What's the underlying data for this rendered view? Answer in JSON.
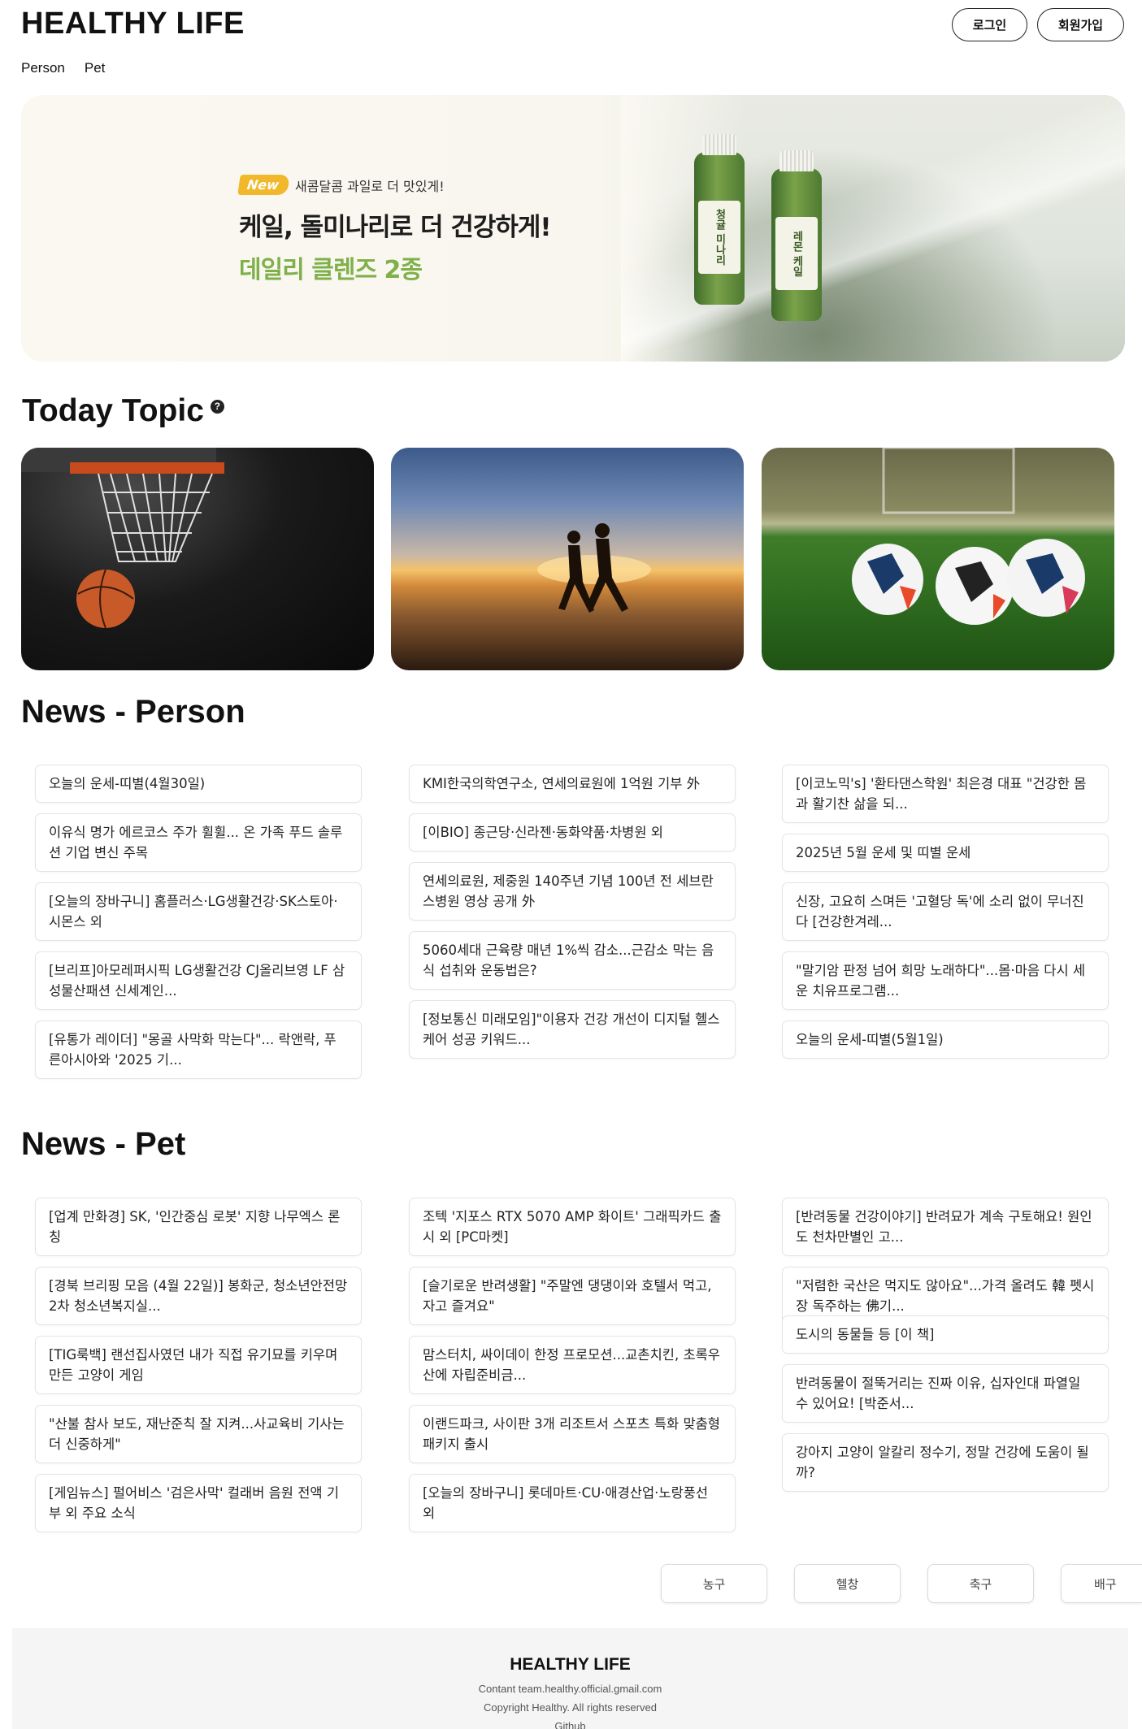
{
  "header": {
    "logo": "HEALTHY LIFE",
    "login_label": "로그인",
    "signup_label": "회원가입"
  },
  "nav": {
    "items": [
      "Person",
      "Pet"
    ]
  },
  "hero": {
    "badge": "New",
    "tagline": "새콤달콤 과일로 더 맛있게!",
    "title": "케일, 돌미나리로 더 건강하게!",
    "subtitle": "데일리 클렌즈 2종",
    "bottle_labels": [
      "청귤 미나리",
      "레몬 케일"
    ]
  },
  "topic": {
    "title": "Today Topic",
    "help_icon": "?"
  },
  "news_person": {
    "title": "News - Person",
    "columns": [
      [
        "오늘의 운세-띠별(4월30일)",
        "이유식 명가 에르코스 주가 휠휠... 온 가족 푸드 솔루션 기업 변신 주목",
        "[오늘의 장바구니] 홈플러스·LG생활건강·SK스토아·시몬스 외",
        "[브리프]아모레퍼시픽 LG생활건강 CJ올리브영 LF 삼성물산패션 신세계인...",
        "[유통가 레이더] \"몽골 사막화 막는다\"... 락앤락, 푸른아시아와 '2025 기..."
      ],
      [
        "KMI한국의학연구소, 연세의료원에 1억원 기부 外",
        "[이BIO] 종근당·신라젠·동화약품·차병원 외",
        "연세의료원, 제중원 140주년 기념 100년 전 세브란스병원 영상 공개 外",
        "5060세대 근육량 매년 1%씩 감소...근감소 막는 음식 섭취와 운동법은?",
        "[정보통신 미래모임]\"이용자 건강 개선이 디지털 헬스케어 성공 키워드..."
      ],
      [
        "[이코노믹's] '환타댄스학원' 최은경 대표 \"건강한 몸과 활기찬 삶을 되...",
        "2025년 5월 운세 및 띠별 운세",
        "신장, 고요히 스며든 '고혈당 독'에 소리 없이 무너진다 [건강한겨레...",
        "\"말기암 판정 넘어 희망 노래하다\"...몸·마음 다시 세운 치유프로그램...",
        "오늘의 운세-띠별(5월1일)"
      ]
    ]
  },
  "news_pet": {
    "title": "News - Pet",
    "columns": [
      [
        "[업계 만화경] SK, '인간중심 로봇' 지향 나무엑스 론칭",
        "[경북 브리핑 모음 (4월 22일)] 봉화군, 청소년안전망 2차 청소년복지실...",
        "[TIG룩백] 랜선집사였던 내가 직접 유기묘를 키우며 만든 고양이 게임",
        "\"산불 참사 보도, 재난준칙 잘 지켜...사교육비 기사는 더 신중하게\"",
        "[게임뉴스] 펄어비스 '검은사막' 컬래버 음원 전액 기부 외 주요 소식"
      ],
      [
        "조텍 '지포스 RTX 5070 AMP 화이트' 그래픽카드 출시 외 [PC마켓]",
        "[슬기로운 반려생활] \"주말엔 댕댕이와 호텔서 먹고, 자고 즐겨요\"",
        "맘스터치, 싸이데이 한정 프로모션...교촌치킨, 초록우산에 자립준비금...",
        "이랜드파크, 사이판 3개 리조트서 스포츠 특화 맞춤형 패키지 출시",
        "[오늘의 장바구니] 롯데마트·CU·애경산업·노랑풍선 외"
      ],
      [
        "[반려동물 건강이야기] 반려묘가 계속 구토해요! 원인도 천차만별인 고...",
        "\"저렴한 국산은 먹지도 않아요\"...가격 올려도 韓 펫시장 독주하는 佛기...",
        "도시의 동물들 등 [이 책]",
        "반려동물이 절뚝거리는 진짜 이유, 십자인대 파열일 수 있어요! [박준서...",
        "강아지 고양이 알칼리 정수기, 정말 건강에 도움이 될까?"
      ]
    ]
  },
  "categories": [
    "농구",
    "헬창",
    "축구",
    "배구"
  ],
  "footer": {
    "logo": "HEALTHY LIFE",
    "contact": "Contant team.healthy.official.gmail.com",
    "copyright": "Copyright Healthy. All rights reserved",
    "github": "Github"
  }
}
